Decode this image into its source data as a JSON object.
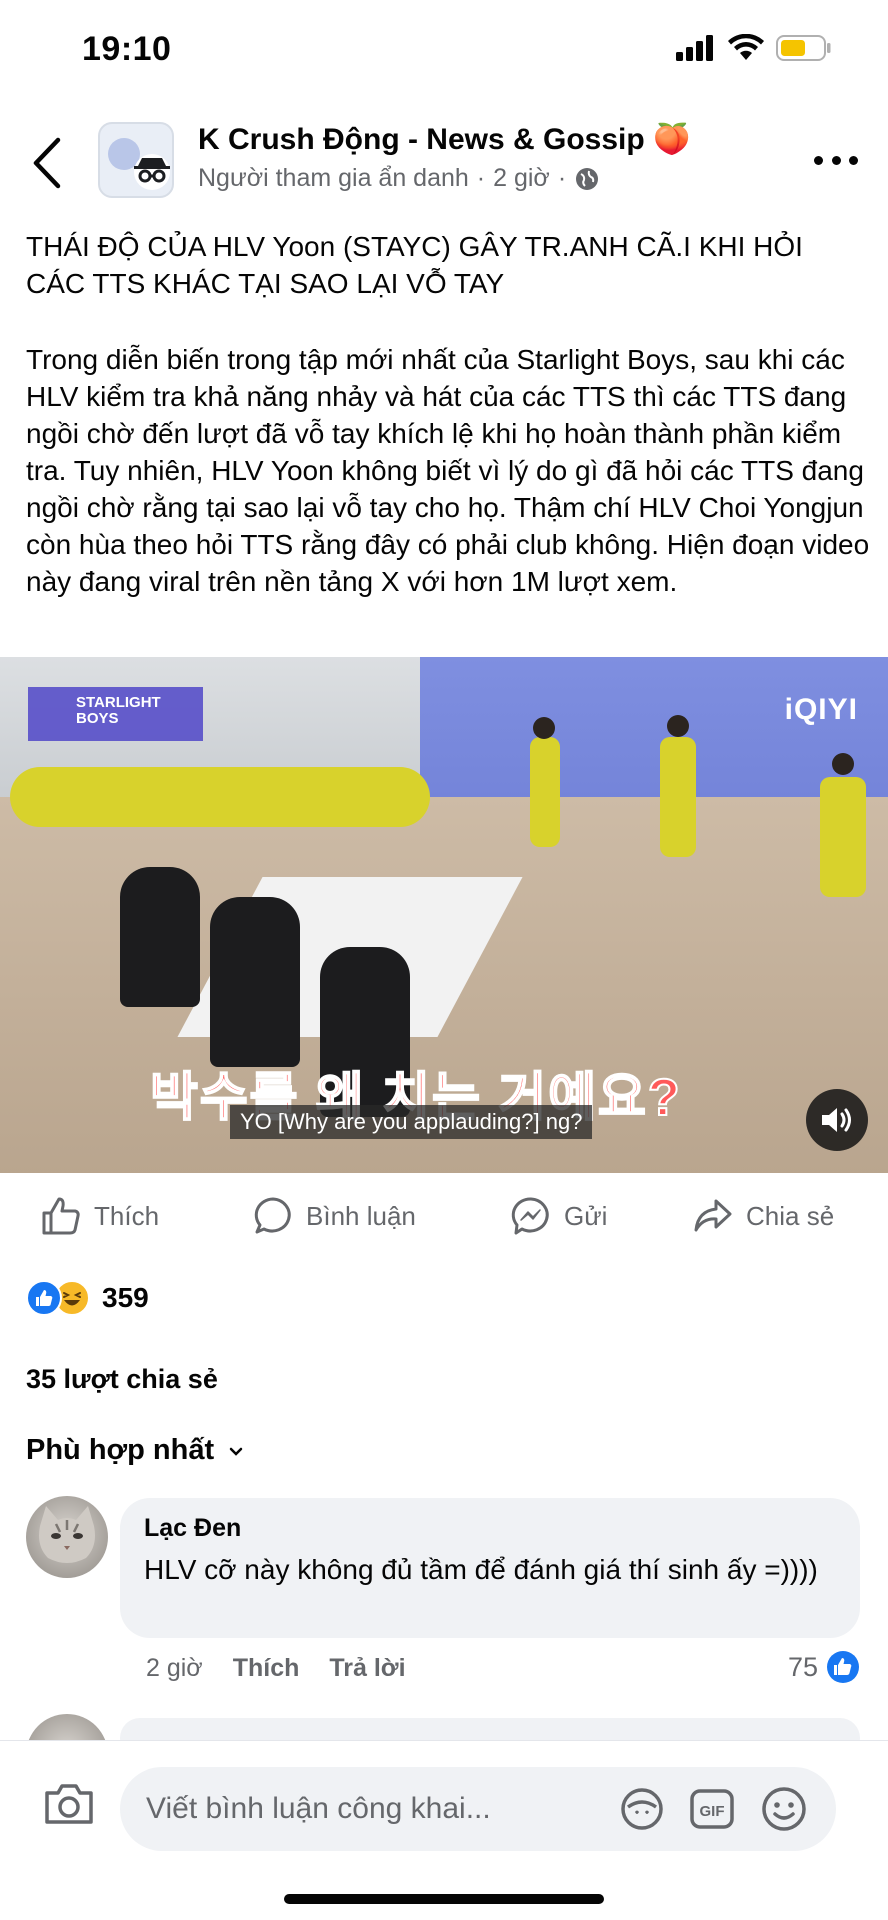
{
  "status": {
    "time": "19:10"
  },
  "header": {
    "group_name": "K Crush Động - News & Gossip 🍑",
    "author": "Người tham gia ẩn danh",
    "time": "2 giờ",
    "separator": "·"
  },
  "post": {
    "title": "THÁI ĐỘ CỦA HLV Yoon (STAYC) GÂY TR.ANH CÃ.I KHI HỎI CÁC TTS KHÁC TẠI SAO LẠI VỖ TAY",
    "body": "Trong diễn biến trong tập mới nhất của Starlight Boys, sau khi các HLV kiểm tra khả năng nhảy và hát của các TTS thì các TTS đang ngồi chờ đến lượt đã vỗ tay khích lệ khi họ hoàn thành phần kiểm tra. Tuy nhiên, HLV Yoon không biết vì lý do gì đã hỏi các TTS đang ngồi chờ rằng tại sao lại vỗ tay cho họ. Thậm chí HLV Choi Yongjun còn hùa theo hỏi TTS rằng đây có phải club không. Hiện đoạn video này đang viral trên nền tảng X với hơn 1M lượt xem."
  },
  "video": {
    "logo_text": "STARLIGHT BOYS",
    "watermark": "iQIYI",
    "korean_caption": "박수를 왜 치는 거예요?",
    "subtitle": "YO [Why are you applauding?] ng?"
  },
  "actions": {
    "like": "Thích",
    "comment": "Bình luận",
    "send": "Gửi",
    "share": "Chia sẻ"
  },
  "reactions": {
    "count": "359"
  },
  "shares": "35 lượt chia sẻ",
  "sort_label": "Phù hợp nhất",
  "comments": [
    {
      "name": "Lạc Đen",
      "text": "HLV cỡ này không đủ tầm để đánh giá thí sinh ấy =))))",
      "time": "2 giờ",
      "like_label": "Thích",
      "reply_label": "Trả lời",
      "likes": "75"
    }
  ],
  "composer": {
    "placeholder": "Viết bình luận công khai..."
  },
  "colors": {
    "accent": "#1877f2",
    "muted": "#65676b",
    "bubble": "#f0f2f5"
  }
}
